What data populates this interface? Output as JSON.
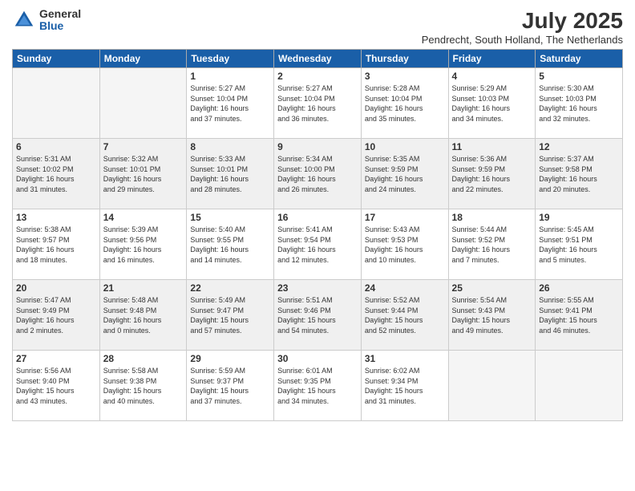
{
  "logo": {
    "general": "General",
    "blue": "Blue"
  },
  "title": "July 2025",
  "location": "Pendrecht, South Holland, The Netherlands",
  "days_of_week": [
    "Sunday",
    "Monday",
    "Tuesday",
    "Wednesday",
    "Thursday",
    "Friday",
    "Saturday"
  ],
  "weeks": [
    [
      {
        "day": "",
        "info": "",
        "empty": true
      },
      {
        "day": "",
        "info": "",
        "empty": true
      },
      {
        "day": "1",
        "info": "Sunrise: 5:27 AM\nSunset: 10:04 PM\nDaylight: 16 hours\nand 37 minutes."
      },
      {
        "day": "2",
        "info": "Sunrise: 5:27 AM\nSunset: 10:04 PM\nDaylight: 16 hours\nand 36 minutes."
      },
      {
        "day": "3",
        "info": "Sunrise: 5:28 AM\nSunset: 10:04 PM\nDaylight: 16 hours\nand 35 minutes."
      },
      {
        "day": "4",
        "info": "Sunrise: 5:29 AM\nSunset: 10:03 PM\nDaylight: 16 hours\nand 34 minutes."
      },
      {
        "day": "5",
        "info": "Sunrise: 5:30 AM\nSunset: 10:03 PM\nDaylight: 16 hours\nand 32 minutes."
      }
    ],
    [
      {
        "day": "6",
        "info": "Sunrise: 5:31 AM\nSunset: 10:02 PM\nDaylight: 16 hours\nand 31 minutes.",
        "shaded": true
      },
      {
        "day": "7",
        "info": "Sunrise: 5:32 AM\nSunset: 10:01 PM\nDaylight: 16 hours\nand 29 minutes.",
        "shaded": true
      },
      {
        "day": "8",
        "info": "Sunrise: 5:33 AM\nSunset: 10:01 PM\nDaylight: 16 hours\nand 28 minutes.",
        "shaded": true
      },
      {
        "day": "9",
        "info": "Sunrise: 5:34 AM\nSunset: 10:00 PM\nDaylight: 16 hours\nand 26 minutes.",
        "shaded": true
      },
      {
        "day": "10",
        "info": "Sunrise: 5:35 AM\nSunset: 9:59 PM\nDaylight: 16 hours\nand 24 minutes.",
        "shaded": true
      },
      {
        "day": "11",
        "info": "Sunrise: 5:36 AM\nSunset: 9:59 PM\nDaylight: 16 hours\nand 22 minutes.",
        "shaded": true
      },
      {
        "day": "12",
        "info": "Sunrise: 5:37 AM\nSunset: 9:58 PM\nDaylight: 16 hours\nand 20 minutes.",
        "shaded": true
      }
    ],
    [
      {
        "day": "13",
        "info": "Sunrise: 5:38 AM\nSunset: 9:57 PM\nDaylight: 16 hours\nand 18 minutes."
      },
      {
        "day": "14",
        "info": "Sunrise: 5:39 AM\nSunset: 9:56 PM\nDaylight: 16 hours\nand 16 minutes."
      },
      {
        "day": "15",
        "info": "Sunrise: 5:40 AM\nSunset: 9:55 PM\nDaylight: 16 hours\nand 14 minutes."
      },
      {
        "day": "16",
        "info": "Sunrise: 5:41 AM\nSunset: 9:54 PM\nDaylight: 16 hours\nand 12 minutes."
      },
      {
        "day": "17",
        "info": "Sunrise: 5:43 AM\nSunset: 9:53 PM\nDaylight: 16 hours\nand 10 minutes."
      },
      {
        "day": "18",
        "info": "Sunrise: 5:44 AM\nSunset: 9:52 PM\nDaylight: 16 hours\nand 7 minutes."
      },
      {
        "day": "19",
        "info": "Sunrise: 5:45 AM\nSunset: 9:51 PM\nDaylight: 16 hours\nand 5 minutes."
      }
    ],
    [
      {
        "day": "20",
        "info": "Sunrise: 5:47 AM\nSunset: 9:49 PM\nDaylight: 16 hours\nand 2 minutes.",
        "shaded": true
      },
      {
        "day": "21",
        "info": "Sunrise: 5:48 AM\nSunset: 9:48 PM\nDaylight: 16 hours\nand 0 minutes.",
        "shaded": true
      },
      {
        "day": "22",
        "info": "Sunrise: 5:49 AM\nSunset: 9:47 PM\nDaylight: 15 hours\nand 57 minutes.",
        "shaded": true
      },
      {
        "day": "23",
        "info": "Sunrise: 5:51 AM\nSunset: 9:46 PM\nDaylight: 15 hours\nand 54 minutes.",
        "shaded": true
      },
      {
        "day": "24",
        "info": "Sunrise: 5:52 AM\nSunset: 9:44 PM\nDaylight: 15 hours\nand 52 minutes.",
        "shaded": true
      },
      {
        "day": "25",
        "info": "Sunrise: 5:54 AM\nSunset: 9:43 PM\nDaylight: 15 hours\nand 49 minutes.",
        "shaded": true
      },
      {
        "day": "26",
        "info": "Sunrise: 5:55 AM\nSunset: 9:41 PM\nDaylight: 15 hours\nand 46 minutes.",
        "shaded": true
      }
    ],
    [
      {
        "day": "27",
        "info": "Sunrise: 5:56 AM\nSunset: 9:40 PM\nDaylight: 15 hours\nand 43 minutes."
      },
      {
        "day": "28",
        "info": "Sunrise: 5:58 AM\nSunset: 9:38 PM\nDaylight: 15 hours\nand 40 minutes."
      },
      {
        "day": "29",
        "info": "Sunrise: 5:59 AM\nSunset: 9:37 PM\nDaylight: 15 hours\nand 37 minutes."
      },
      {
        "day": "30",
        "info": "Sunrise: 6:01 AM\nSunset: 9:35 PM\nDaylight: 15 hours\nand 34 minutes."
      },
      {
        "day": "31",
        "info": "Sunrise: 6:02 AM\nSunset: 9:34 PM\nDaylight: 15 hours\nand 31 minutes."
      },
      {
        "day": "",
        "info": "",
        "empty": true
      },
      {
        "day": "",
        "info": "",
        "empty": true
      }
    ]
  ]
}
